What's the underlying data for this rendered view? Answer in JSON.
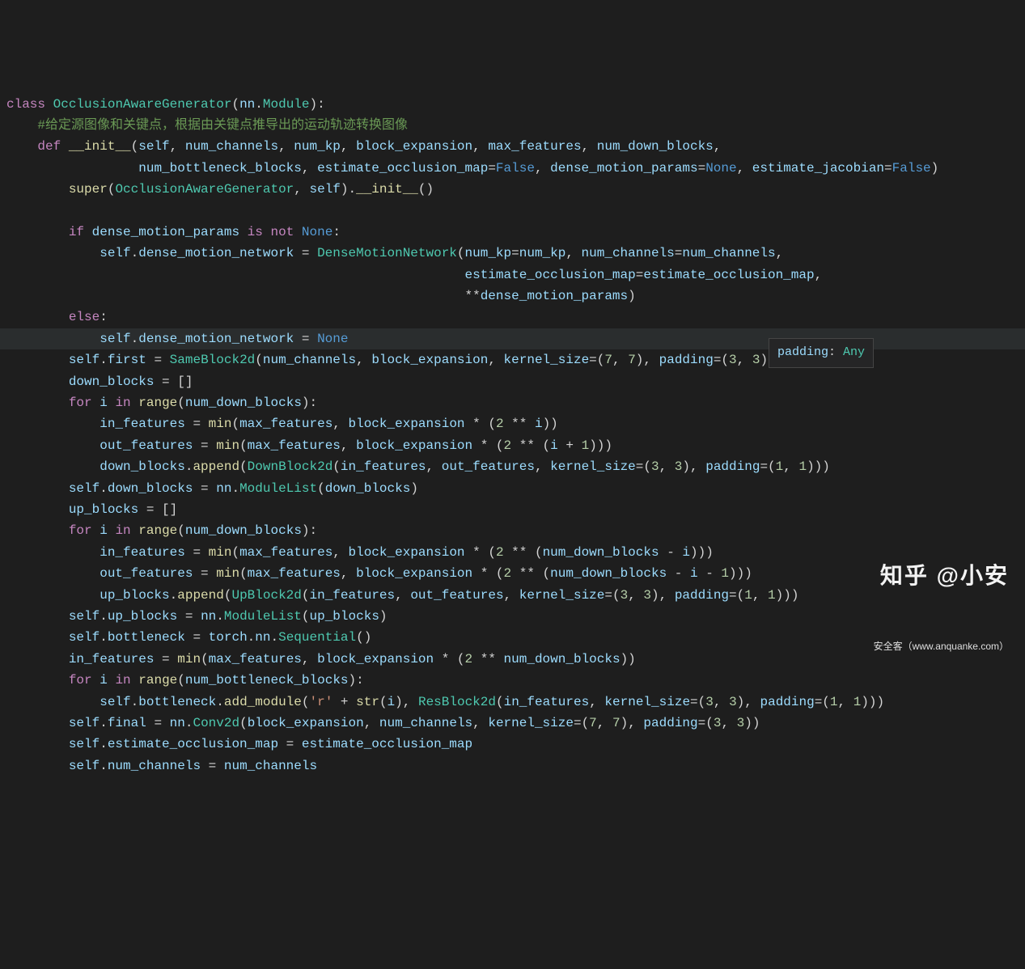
{
  "code": {
    "keywords": {
      "class": "class",
      "def": "def",
      "if": "if",
      "is": "is",
      "not": "not",
      "else": "else",
      "for": "for",
      "in": "in"
    },
    "class_decl": {
      "name": "OcclusionAwareGenerator",
      "base_mod": "nn",
      "base_cls": "Module"
    },
    "comment_cn": "#给定源图像和关键点，根据由关键点推导出的运动轨迹转换图像",
    "init_def": {
      "name": "__init__",
      "self": "self",
      "params_line1": {
        "p1": "num_channels",
        "p2": "num_kp",
        "p3": "block_expansion",
        "p4": "max_features",
        "p5": "num_down_blocks"
      },
      "params_line2": {
        "p6": "num_bottleneck_blocks",
        "p7": "estimate_occlusion_map",
        "p7v": "False",
        "p8": "dense_motion_params",
        "p8v": "None",
        "p9": "estimate_jacobian",
        "p9v": "False"
      }
    },
    "super_call": {
      "super": "super",
      "arg1": "OcclusionAwareGenerator",
      "arg2": "self",
      "init": "__init__"
    },
    "dense_motion_if": {
      "cond_var": "dense_motion_params",
      "none": "None",
      "assign_target_self": "self",
      "assign_target_attr": "dense_motion_network",
      "ctor": "DenseMotionNetwork",
      "kw1": "num_kp",
      "kv1": "num_kp",
      "kw2": "num_channels",
      "kv2": "num_channels",
      "kw3": "estimate_occlusion_map",
      "kv3": "estimate_occlusion_map",
      "kw4_stars": "**",
      "kw4": "dense_motion_params"
    },
    "dense_motion_else": {
      "assign_target_self": "self",
      "assign_target_attr": "dense_motion_network",
      "none": "None"
    },
    "first_assign": {
      "self": "self",
      "attr": "first",
      "ctor": "SameBlock2d",
      "a1": "num_channels",
      "a2": "block_expansion",
      "kk": "kernel_size",
      "kv1": "7",
      "kv2": "7",
      "pk": "padding",
      "pv1": "3",
      "pv2": "3"
    },
    "down_init": "down_blocks",
    "loop1": {
      "i": "i",
      "range": "range",
      "arg": "num_down_blocks",
      "in_features": "in_features",
      "min": "min",
      "mf": "max_features",
      "be": "block_expansion",
      "two": "2",
      "n1": "1",
      "out_features": "out_features",
      "append": "append",
      "ctor": "DownBlock2d",
      "ks": "kernel_size",
      "kv": "3",
      "pk": "padding",
      "pv": "1"
    },
    "down_assign": {
      "self": "self",
      "attr": "down_blocks",
      "nn": "nn",
      "ml": "ModuleList",
      "arg": "down_blocks"
    },
    "up_init": "up_blocks",
    "loop2": {
      "i": "i",
      "range": "range",
      "arg": "num_down_blocks",
      "in_features": "in_features",
      "min": "min",
      "mf": "max_features",
      "be": "block_expansion",
      "two": "2",
      "ndb": "num_down_blocks",
      "n1": "1",
      "out_features": "out_features",
      "append": "append",
      "ctor": "UpBlock2d",
      "ks": "kernel_size",
      "kv": "3",
      "pk": "padding",
      "pv": "1"
    },
    "up_assign": {
      "self": "self",
      "attr": "up_blocks",
      "nn": "nn",
      "ml": "ModuleList",
      "arg": "up_blocks"
    },
    "bottleneck": {
      "self": "self",
      "attr": "bottleneck",
      "torch": "torch",
      "nn": "nn",
      "seq": "Sequential"
    },
    "in_feat2": {
      "var": "in_features",
      "min": "min",
      "mf": "max_features",
      "be": "block_expansion",
      "two": "2",
      "ndb": "num_down_blocks"
    },
    "loop3": {
      "i": "i",
      "range": "range",
      "arg": "num_bottleneck_blocks",
      "self": "self",
      "b": "bottleneck",
      "am": "add_module",
      "rstr": "'r'",
      "plus": "+",
      "str": "str",
      "ctor": "ResBlock2d",
      "inf": "in_features",
      "ks": "kernel_size",
      "kv": "3",
      "pk": "padding",
      "pv": "1"
    },
    "final": {
      "self": "self",
      "attr": "final",
      "nn": "nn",
      "conv": "Conv2d",
      "be": "block_expansion",
      "nc": "num_channels",
      "ks": "kernel_size",
      "kv": "7",
      "pk": "padding",
      "pv": "3"
    },
    "est_occ": {
      "self": "self",
      "attr": "estimate_occlusion_map",
      "val": "estimate_occlusion_map"
    },
    "num_ch": {
      "self": "self",
      "attr": "num_channels",
      "val": "num_channels"
    }
  },
  "tooltip": {
    "text": "padding: Any"
  },
  "watermark": {
    "main": "知乎 @小安",
    "sub": "安全客（www.anquanke.com）"
  }
}
